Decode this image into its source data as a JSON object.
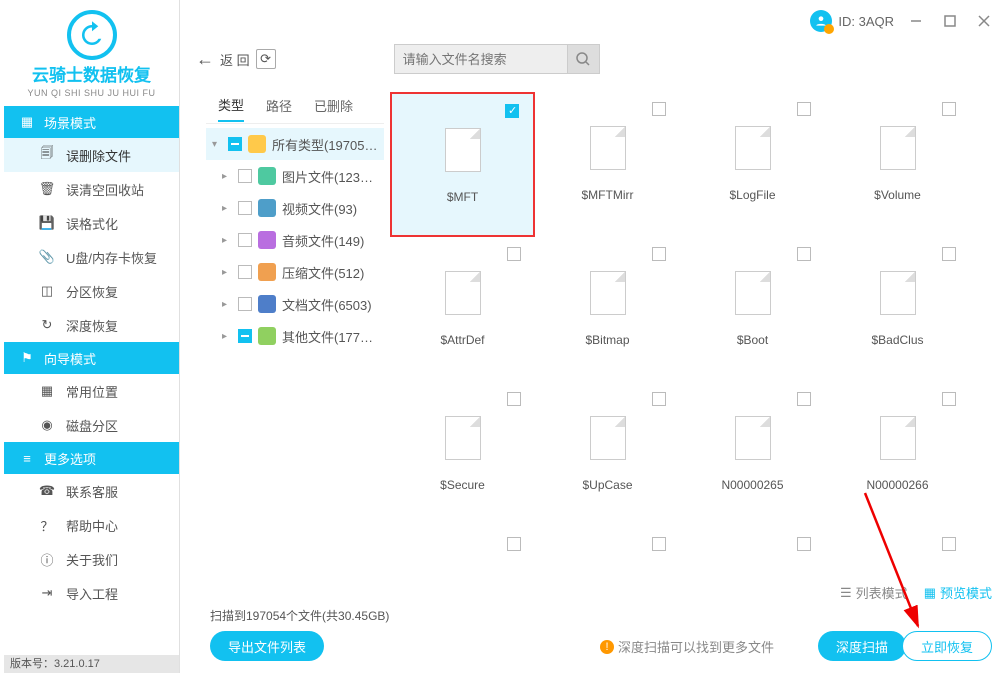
{
  "logo": {
    "title": "云骑士数据恢复",
    "sub": "YUN QI SHI SHU JU HUI FU"
  },
  "header": {
    "id_label": "ID: 3AQR"
  },
  "sidebar": {
    "section_scene": "场景模式",
    "scene_items": [
      {
        "label": "误删除文件"
      },
      {
        "label": "误清空回收站"
      },
      {
        "label": "误格式化"
      },
      {
        "label": "U盘/内存卡恢复"
      },
      {
        "label": "分区恢复"
      },
      {
        "label": "深度恢复"
      }
    ],
    "section_wizard": "向导模式",
    "wizard_items": [
      {
        "label": "常用位置"
      },
      {
        "label": "磁盘分区"
      }
    ],
    "section_more": "更多选项",
    "more_items": [
      {
        "label": "联系客服"
      },
      {
        "label": "帮助中心"
      },
      {
        "label": "关于我们"
      },
      {
        "label": "导入工程"
      }
    ]
  },
  "version": "版本号：3.21.0.17",
  "toolbar": {
    "back": "返    回",
    "search_placeholder": "请输入文件名搜索"
  },
  "tabs": {
    "type": "类型",
    "path": "路径",
    "deleted": "已删除"
  },
  "tree": [
    {
      "label": "所有类型(19705…",
      "cls": "ic-folder",
      "some": true,
      "root": true
    },
    {
      "label": "图片文件(123…",
      "cls": "ic-img",
      "some": false
    },
    {
      "label": "视频文件(93)",
      "cls": "ic-video",
      "some": false
    },
    {
      "label": "音频文件(149)",
      "cls": "ic-audio",
      "some": false
    },
    {
      "label": "压缩文件(512)",
      "cls": "ic-zip",
      "some": false
    },
    {
      "label": "文档文件(6503)",
      "cls": "ic-doc",
      "some": false
    },
    {
      "label": "其他文件(177…",
      "cls": "ic-other",
      "some": true
    }
  ],
  "files": [
    {
      "name": "$MFT",
      "selected": true,
      "checked": true
    },
    {
      "name": "$MFTMirr",
      "selected": false,
      "checked": false
    },
    {
      "name": "$LogFile",
      "selected": false,
      "checked": false
    },
    {
      "name": "$Volume",
      "selected": false,
      "checked": false
    },
    {
      "name": "$AttrDef",
      "selected": false,
      "checked": false
    },
    {
      "name": "$Bitmap",
      "selected": false,
      "checked": false
    },
    {
      "name": "$Boot",
      "selected": false,
      "checked": false
    },
    {
      "name": "$BadClus",
      "selected": false,
      "checked": false
    },
    {
      "name": "$Secure",
      "selected": false,
      "checked": false
    },
    {
      "name": "$UpCase",
      "selected": false,
      "checked": false
    },
    {
      "name": "N00000265",
      "selected": false,
      "checked": false
    },
    {
      "name": "N00000266",
      "selected": false,
      "checked": false
    },
    {
      "name": "",
      "selected": false,
      "checked": false
    },
    {
      "name": "",
      "selected": false,
      "checked": false
    },
    {
      "name": "",
      "selected": false,
      "checked": false
    },
    {
      "name": "",
      "selected": false,
      "checked": false
    }
  ],
  "bottom": {
    "list_mode": "列表模式",
    "preview_mode": "预览模式",
    "status": "扫描到197054个文件(共30.45GB)",
    "export": "导出文件列表",
    "tip": "深度扫描可以找到更多文件",
    "deep_scan": "深度扫描",
    "recover": "立即恢复"
  }
}
